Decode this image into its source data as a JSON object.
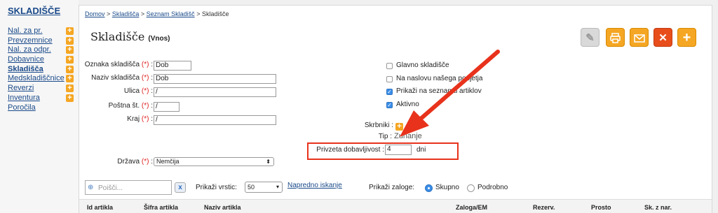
{
  "sidebar": {
    "title": "SKLADIŠČE",
    "items": [
      {
        "label": "Nal. za pr.",
        "has_add": true
      },
      {
        "label": "Prevzemnice",
        "has_add": true
      },
      {
        "label": "Nal. za odpr.",
        "has_add": true
      },
      {
        "label": "Dobavnice",
        "has_add": true
      },
      {
        "label": "Skladišča",
        "has_add": true,
        "active": true
      },
      {
        "label": "Medskladiščnice",
        "has_add": true
      },
      {
        "label": "Reverzi",
        "has_add": true
      },
      {
        "label": "Inventura",
        "has_add": true
      },
      {
        "label": "Poročila",
        "has_add": false
      }
    ]
  },
  "breadcrumb": {
    "home": "Domov",
    "sep": ">",
    "crumb1": "Skladišča",
    "crumb2": "Seznam Skladišč",
    "current": "Skladišče"
  },
  "header": {
    "title": "Skladišče",
    "subtitle": "(Vnos)"
  },
  "form": {
    "required_mark": "(*)",
    "oznaka": {
      "label": "Oznaka skladišča",
      "value": "Dob"
    },
    "naziv": {
      "label": "Naziv skladišča",
      "value": "Dob"
    },
    "ulica": {
      "label": "Ulica",
      "value": "/"
    },
    "postna": {
      "label": "Poštna št.",
      "value": "/"
    },
    "kraj": {
      "label": "Kraj",
      "value": "/"
    },
    "drzava": {
      "label": "Država",
      "value": "Nemčija"
    },
    "colon": ":"
  },
  "options": {
    "glavno": {
      "label": "Glavno skladišče",
      "checked": false
    },
    "naslov": {
      "label": "Na naslovu našega podjetja",
      "checked": false
    },
    "prikazi": {
      "label": "Prikaži na seznamu artiklov",
      "checked": true
    },
    "aktivno": {
      "label": "Aktivno",
      "checked": true
    },
    "skrbniki_label": "Skrbniki :",
    "tip_label": "Tip :",
    "tip_value": "Zunanje",
    "privzeta_label": "Privzeta dobavljivost :",
    "privzeta_value": "4",
    "privzeta_unit": "dni"
  },
  "list": {
    "search_placeholder": "Poišči...",
    "clear": "x",
    "rows_label": "Prikaži vrstic:",
    "rows_value": "50",
    "advanced": "Napredno iskanje",
    "zaloge_label": "Prikaži zaloge:",
    "skupno": "Skupno",
    "podrobno": "Podrobno",
    "columns": [
      "Id artikla",
      "Šifra artikla",
      "Naziv artikla",
      "Zaloga/EM",
      "Rezerv.",
      "Prosto",
      "Sk. z nar."
    ]
  },
  "colors": {
    "accent_orange": "#f5a623",
    "delete_red": "#e84e1b",
    "annotation_red": "#e8321c",
    "link_blue": "#1a4a8a"
  }
}
